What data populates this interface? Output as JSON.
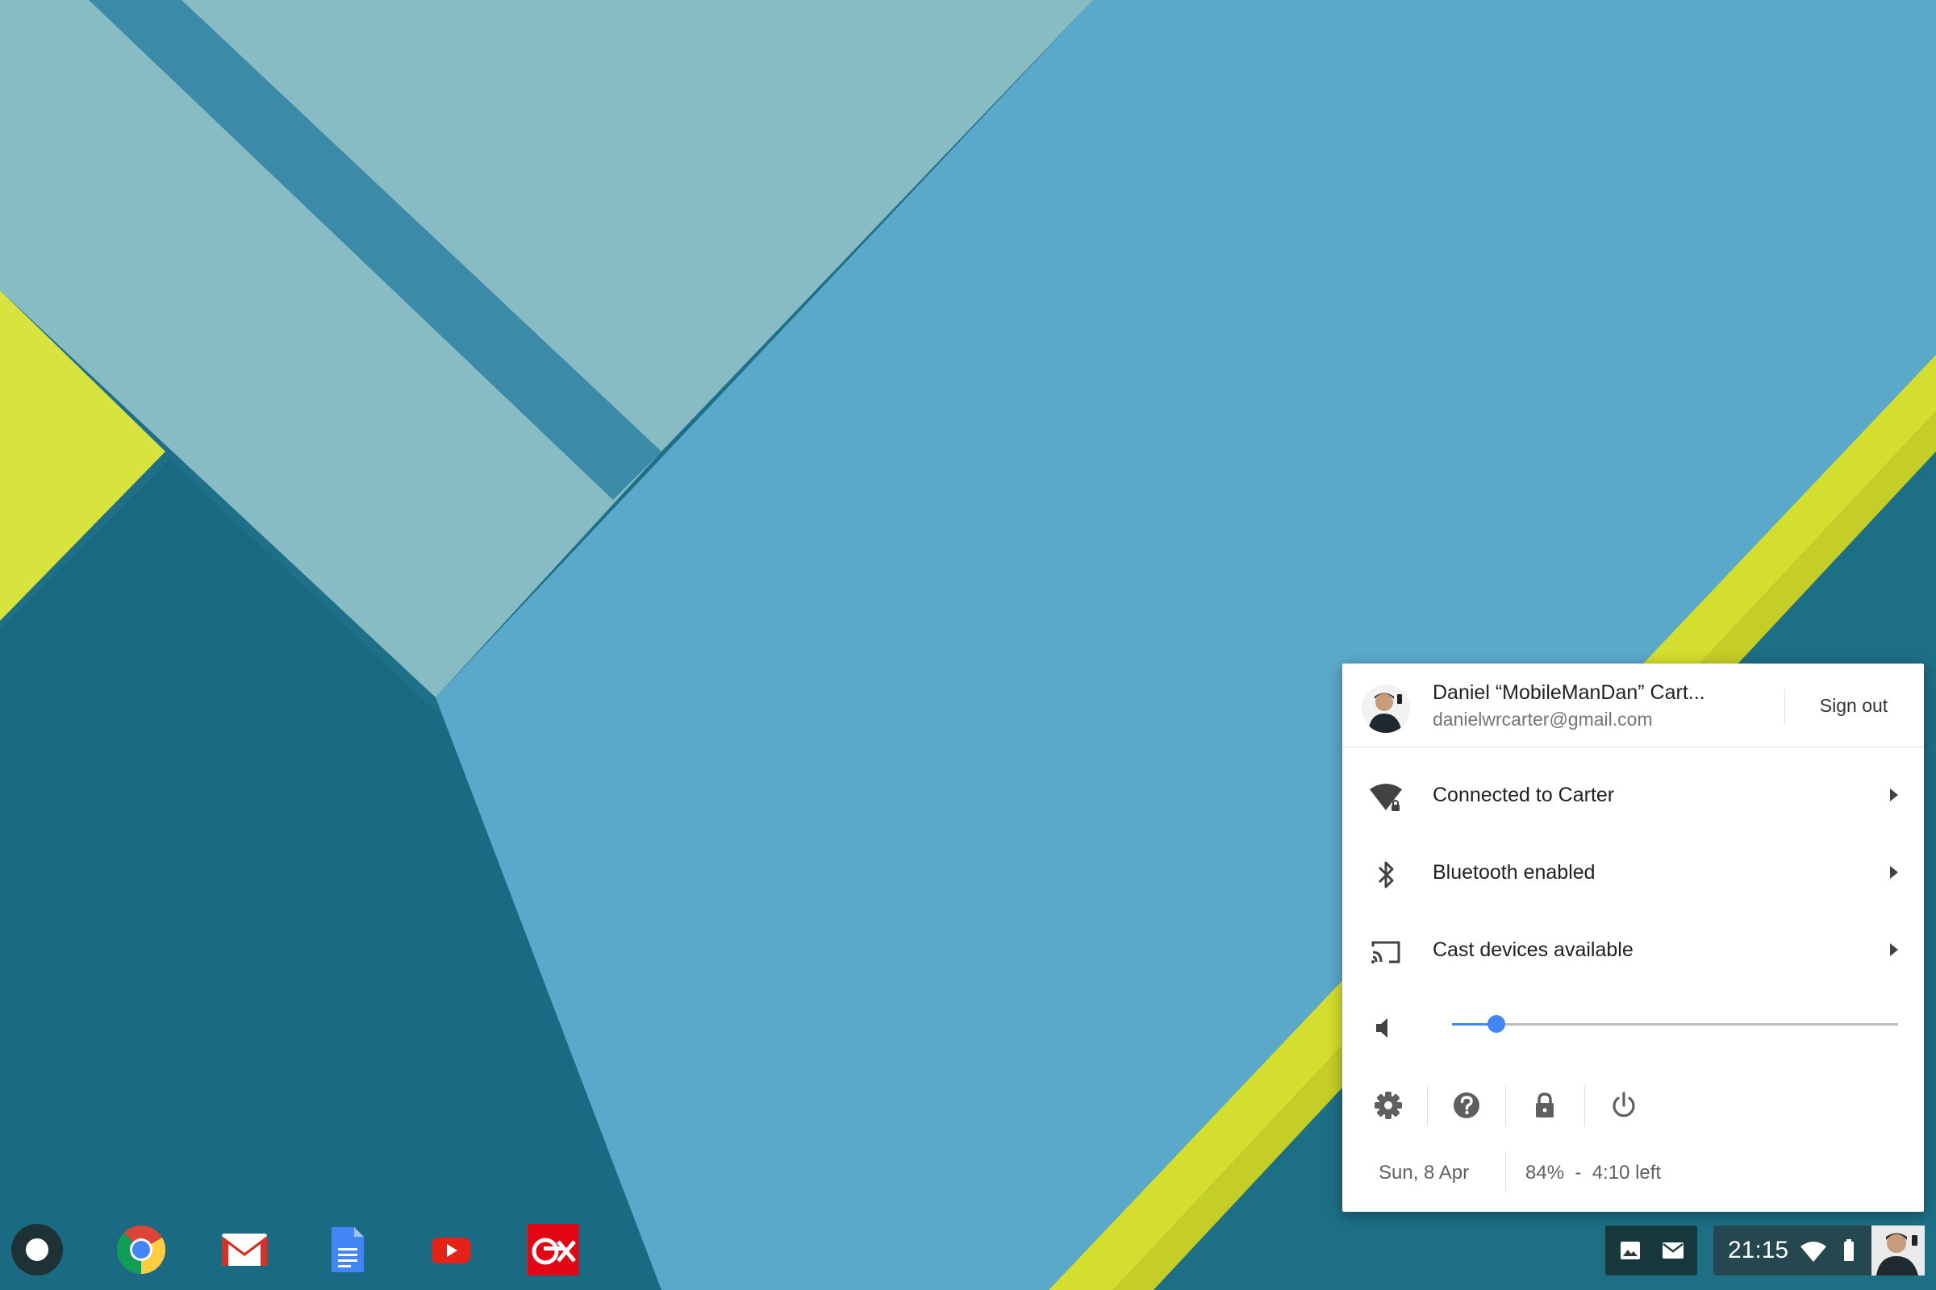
{
  "desktop": {
    "wallpaper": "material-design-paper-layers"
  },
  "tray": {
    "user": {
      "name": "Daniel “MobileManDan” Cart...",
      "email": "danielwrcarter@gmail.com",
      "sign_out": "Sign out"
    },
    "items": [
      {
        "icon": "wifi-locked-icon",
        "label": "Connected to Carter"
      },
      {
        "icon": "bluetooth-icon",
        "label": "Bluetooth enabled"
      },
      {
        "icon": "cast-icon",
        "label": "Cast devices available"
      }
    ],
    "volume": {
      "icon": "volume-icon",
      "level_percent": 10
    },
    "tools": [
      "settings-icon",
      "help-icon",
      "lock-icon",
      "power-icon"
    ],
    "date": "Sun, 8 Apr",
    "battery": "84%  -  4:10 left"
  },
  "shelf": {
    "apps": [
      {
        "name": "launcher",
        "icon": "launcher-icon"
      },
      {
        "name": "chrome",
        "icon": "chrome-icon"
      },
      {
        "name": "gmail",
        "icon": "gmail-icon"
      },
      {
        "name": "docs",
        "icon": "docs-icon"
      },
      {
        "name": "youtube",
        "icon": "youtube-icon"
      },
      {
        "name": "cex",
        "icon": "cex-icon"
      }
    ],
    "notification_icons": [
      "image-icon",
      "mail-icon"
    ],
    "clock": "21:15",
    "status_icons": [
      "wifi-icon",
      "battery-icon"
    ]
  },
  "colors": {
    "accent": "#4285f4",
    "tray_bg": "#ffffff",
    "text_primary": "#212121",
    "text_secondary": "#757575"
  }
}
